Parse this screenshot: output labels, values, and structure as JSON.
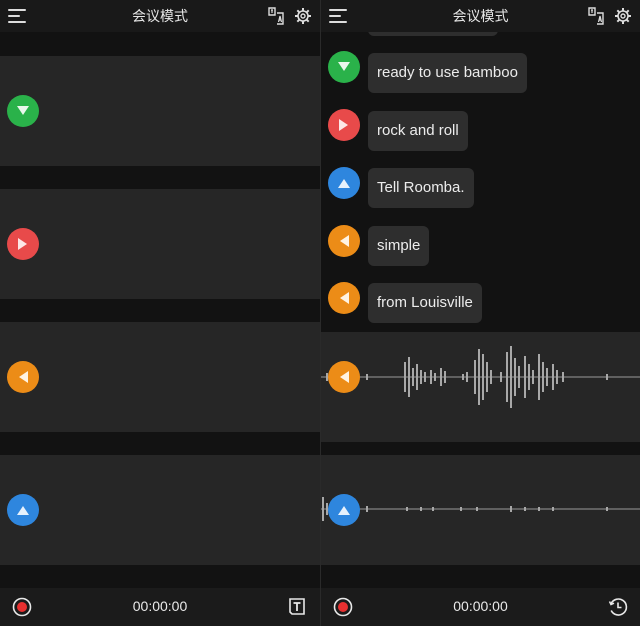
{
  "app": {
    "title": "会议模式"
  },
  "left_panel": {
    "timer": "00:00:00",
    "speakers": [
      {
        "color": "#2ab24a",
        "direction": "down"
      },
      {
        "color": "#e84a4a",
        "direction": "right"
      },
      {
        "color": "#ec8c17",
        "direction": "left"
      },
      {
        "color": "#2e86de",
        "direction": "up"
      }
    ]
  },
  "right_panel": {
    "timer": "00:00:00",
    "messages": [
      {
        "text": "ready to use bamboo",
        "color": "#2ab24a",
        "direction": "down"
      },
      {
        "text": "rock and roll",
        "color": "#e84a4a",
        "direction": "right"
      },
      {
        "text": "Tell Roomba.",
        "color": "#2e86de",
        "direction": "up"
      },
      {
        "text": "simple",
        "color": "#ec8c17",
        "direction": "left"
      },
      {
        "text": "from Louisville",
        "color": "#ec8c17",
        "direction": "left"
      }
    ],
    "live_tracks": [
      {
        "color": "#ec8c17",
        "direction": "left"
      },
      {
        "color": "#2e86de",
        "direction": "up"
      }
    ]
  },
  "icons": {
    "menu": "menu-icon",
    "translate": "translate-icon",
    "settings": "gear-icon",
    "record": "record-icon",
    "text": "text-icon",
    "history": "history-icon"
  },
  "colors": {
    "record": "#e83030",
    "background": "#121212",
    "track": "#262626"
  }
}
